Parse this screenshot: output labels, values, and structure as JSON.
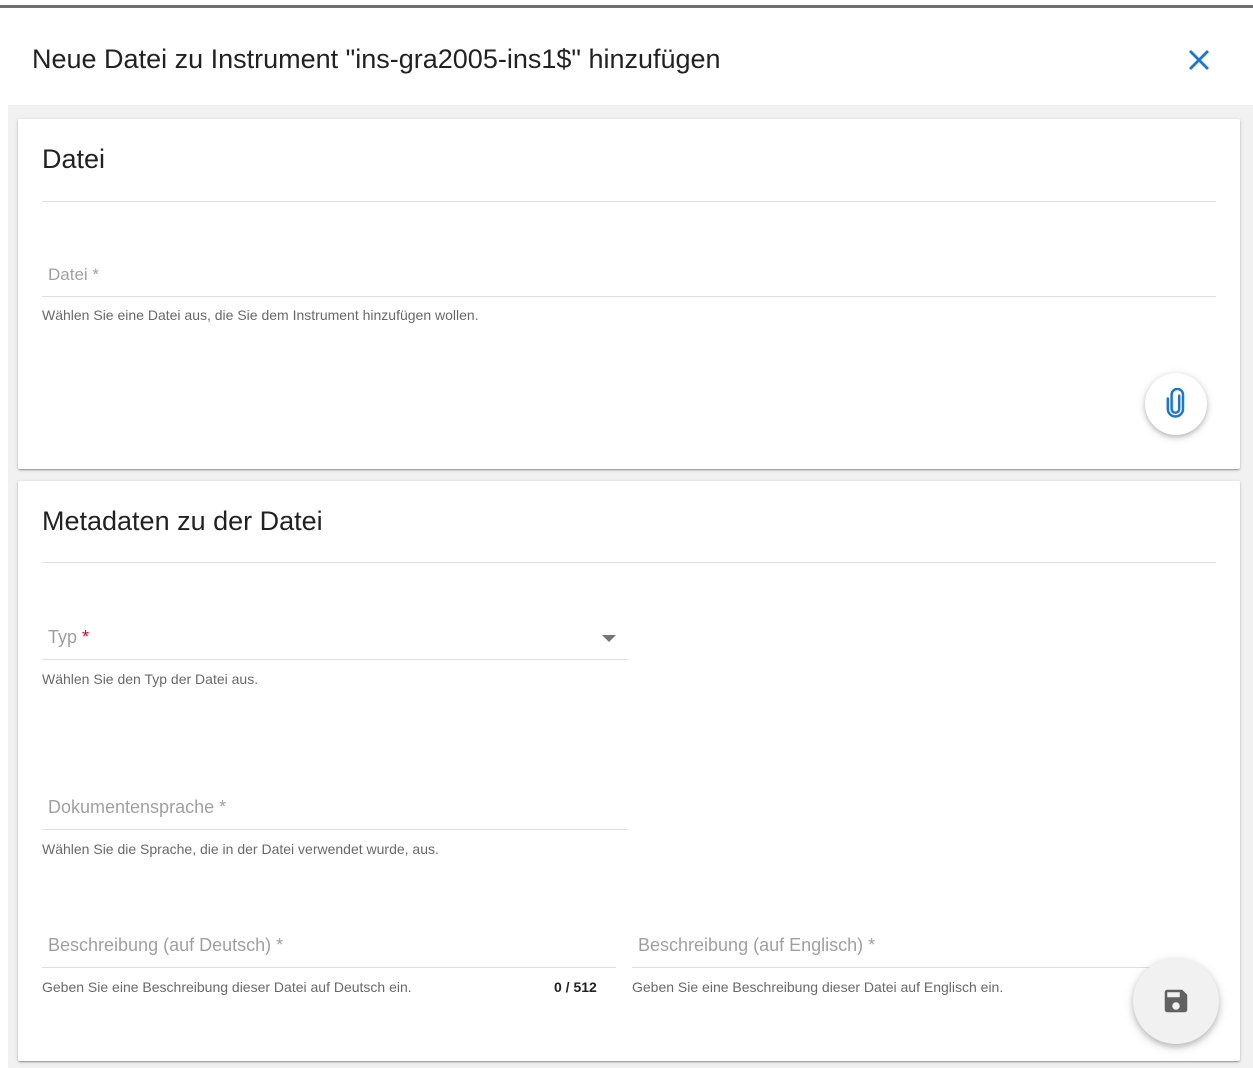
{
  "dialog": {
    "title": "Neue Datei zu Instrument \"ins-gra2005-ins1$\" hinzufügen",
    "close_icon": "close-icon"
  },
  "file_section": {
    "title": "Datei",
    "file_field": {
      "label": "Datei *",
      "hint": "Wählen Sie eine Datei aus, die Sie dem Instrument hinzufügen wollen."
    },
    "attach_icon": "paperclip-icon"
  },
  "metadata_section": {
    "title": "Metadaten zu der Datei",
    "type_field": {
      "label": "Typ",
      "required_marker": "*",
      "hint": "Wählen Sie den Typ der Datei aus."
    },
    "language_field": {
      "label": "Dokumentensprache *",
      "hint": "Wählen Sie die Sprache, die in der Datei verwendet wurde, aus."
    },
    "description_de": {
      "label": "Beschreibung (auf Deutsch) *",
      "hint": "Geben Sie eine Beschreibung dieser Datei auf Deutsch ein.",
      "counter": "0 / 512"
    },
    "description_en": {
      "label": "Beschreibung (auf Englisch) *",
      "hint": "Geben Sie eine Beschreibung dieser Datei auf Englisch ein."
    },
    "save_icon": "floppy-disk-icon"
  },
  "colors": {
    "accent": "#1976d2",
    "required": "#e0002a",
    "background": "#f1f1f1"
  }
}
